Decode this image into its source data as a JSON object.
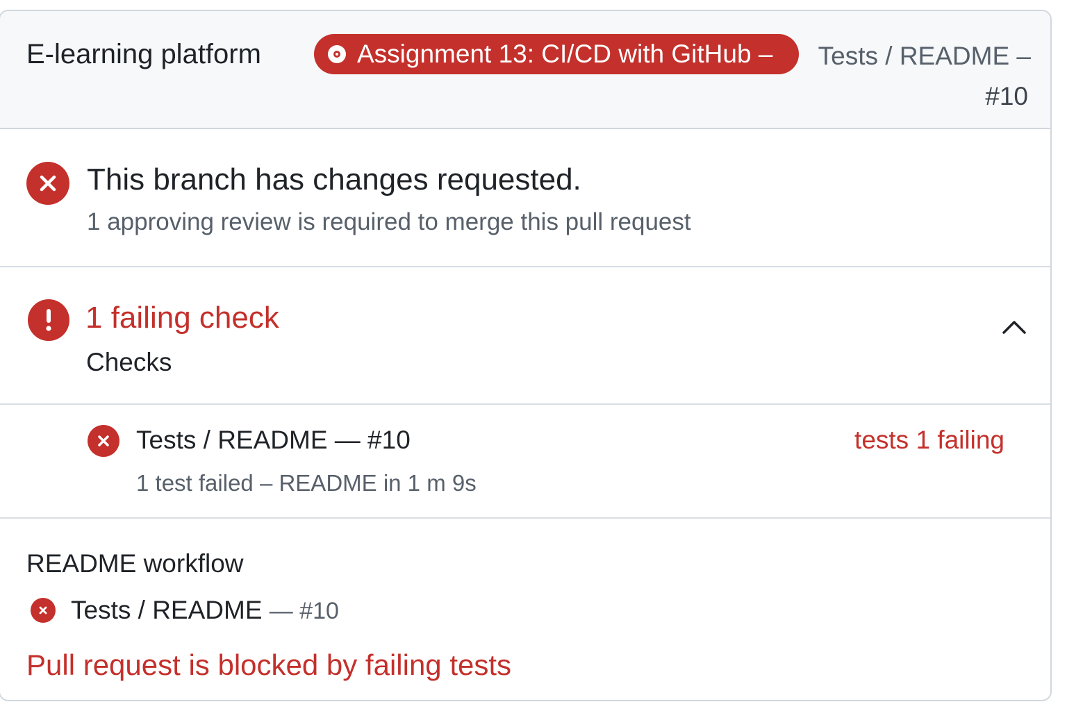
{
  "header": {
    "repo_name": "E-learning platform",
    "pr_title": "Assignment 13: CI/CD with GitHub –",
    "pr_title_icon": "git-pull-request-icon",
    "right_line1": "Tests / README –",
    "right_line2": "#10"
  },
  "review_status": {
    "icon": "x-circle-icon",
    "title": "This branch has changes requested.",
    "subtitle": "1 approving review is required to merge this pull request"
  },
  "checks": {
    "icon": "alert-circle-icon",
    "title": "1 failing check",
    "subtitle": "Checks",
    "toggle_icon": "chevron-up-icon",
    "items": [
      {
        "icon": "x-circle-icon",
        "name": "Tests / README — #10",
        "detail": "1 test failed – README in 1 m 9s",
        "status": "tests 1 failing"
      }
    ]
  },
  "workflow": {
    "title": "README workflow",
    "run_name": "Tests / README",
    "run_number": "— #10",
    "run_icon": "x-circle-icon",
    "blocked_message": "Pull request is blocked by failing tests"
  },
  "colors": {
    "danger": "#c4302b",
    "header_bg": "#f6f8fa",
    "border": "#d0d7de",
    "text": "#1f2328",
    "muted": "#57606a"
  }
}
